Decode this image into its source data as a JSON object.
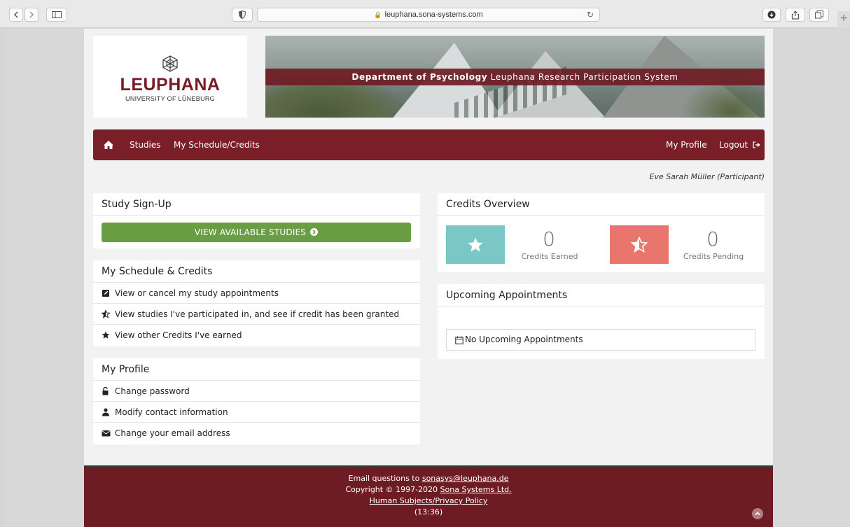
{
  "browser": {
    "url": "leuphana.sona-systems.com"
  },
  "logo": {
    "name": "LEUPHANA",
    "subtitle": "UNIVERSITY OF LÜNEBURG"
  },
  "banner": {
    "bold": "Department of Psychology",
    "rest": " Leuphana Research Participation System"
  },
  "nav": {
    "studies": "Studies",
    "schedule": "My Schedule/Credits",
    "profile": "My Profile",
    "logout": "Logout"
  },
  "user": {
    "name": "Eve Sarah Müller (Participant)"
  },
  "signup": {
    "title": "Study Sign-Up",
    "button": "VIEW AVAILABLE STUDIES"
  },
  "schedule": {
    "title": "My Schedule & Credits",
    "items": [
      {
        "label": "View or cancel my study appointments",
        "icon": "edit-icon"
      },
      {
        "label": "View studies I've participated in, and see if credit has been granted",
        "icon": "star-half-icon"
      },
      {
        "label": "View other Credits I've earned",
        "icon": "star-icon"
      }
    ]
  },
  "profile": {
    "title": "My Profile",
    "items": [
      {
        "label": "Change password",
        "icon": "unlock-icon"
      },
      {
        "label": "Modify contact information",
        "icon": "user-icon"
      },
      {
        "label": "Change your email address",
        "icon": "envelope-icon"
      }
    ]
  },
  "credits": {
    "title": "Credits Overview",
    "earned_value": "0",
    "earned_label": "Credits Earned",
    "pending_value": "0",
    "pending_label": "Credits Pending"
  },
  "appointments": {
    "title": "Upcoming Appointments",
    "empty": "No Upcoming Appointments"
  },
  "footer": {
    "email_prefix": "Email questions to ",
    "email": "sonasys@leuphana.de",
    "copyright_prefix": "Copyright © 1997-2020 ",
    "company": "Sona Systems Ltd.",
    "privacy": "Human Subjects/Privacy Policy",
    "time": "(13:36)"
  },
  "colors": {
    "brand": "#7a1e27",
    "green": "#6a9e45",
    "teal": "#7bc6c6",
    "salmon": "#e8766c"
  }
}
